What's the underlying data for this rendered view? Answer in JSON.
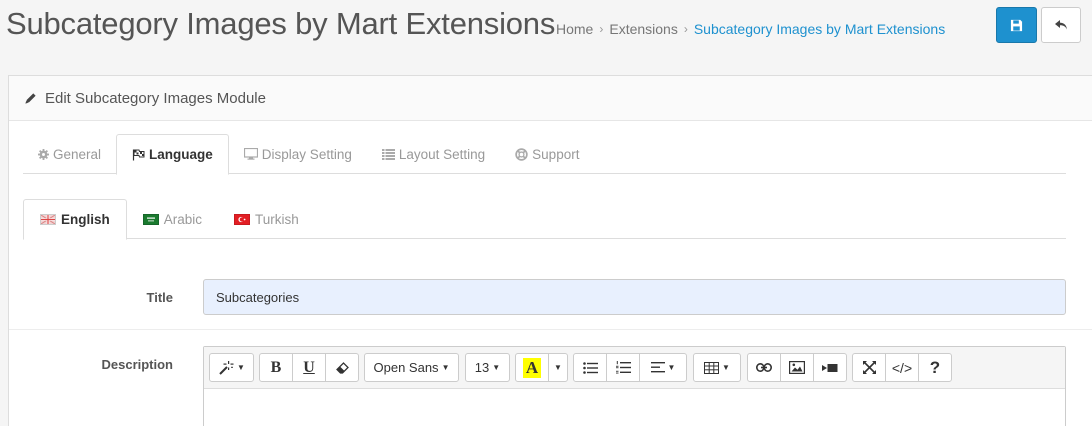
{
  "header": {
    "title": "Subcategory Images by Mart Extensions",
    "breadcrumb": [
      "Home",
      "Extensions",
      "Subcategory Images by Mart Extensions"
    ],
    "separator": "›"
  },
  "panel": {
    "heading": "Edit Subcategory Images Module"
  },
  "tabs": [
    {
      "label": "General",
      "icon": "gear-icon"
    },
    {
      "label": "Language",
      "icon": "flag-icon"
    },
    {
      "label": "Display Setting",
      "icon": "monitor-icon"
    },
    {
      "label": "Layout Setting",
      "icon": "list-icon"
    },
    {
      "label": "Support",
      "icon": "lifebuoy-icon"
    }
  ],
  "active_tab": "Language",
  "language_tabs": [
    {
      "label": "English",
      "flag": "uk-flag-icon"
    },
    {
      "label": "Arabic",
      "flag": "saudi-flag-icon"
    },
    {
      "label": "Turkish",
      "flag": "turkey-flag-icon"
    }
  ],
  "active_language": "English",
  "form": {
    "title_label": "Title",
    "title_value": "Subcategories",
    "description_label": "Description"
  },
  "editor_toolbar": {
    "font_family": "Open Sans",
    "font_size": "13",
    "color_letter": "A",
    "bold": "B",
    "underline": "U",
    "help": "?",
    "code": "</>"
  },
  "colors": {
    "primary": "#1e91cf",
    "input_bg": "#e8f0fe",
    "highlight": "#ffff00"
  }
}
